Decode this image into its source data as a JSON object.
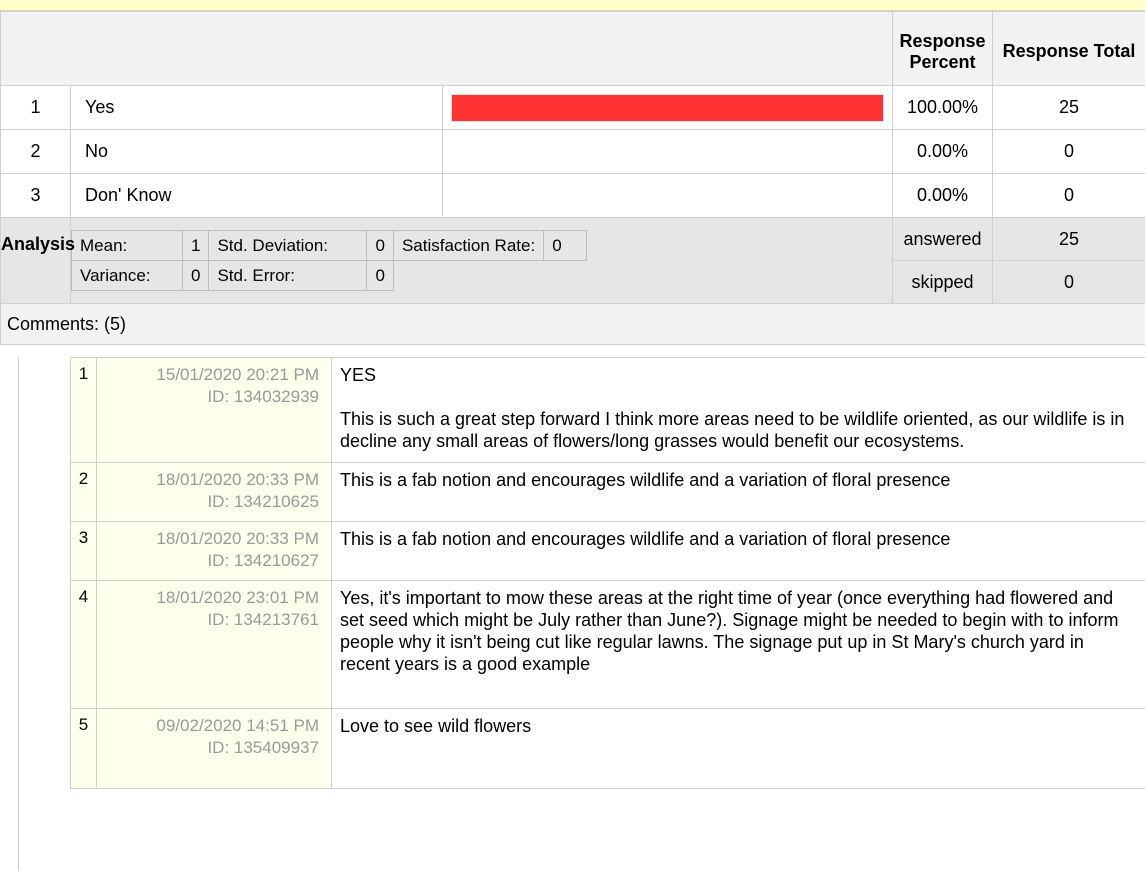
{
  "columns": {
    "response_percent": "Response Percent",
    "response_total": "Response Total"
  },
  "answers": [
    {
      "num": "1",
      "label": "Yes",
      "fraction": 1.0,
      "percent": "100.00%",
      "total": "25"
    },
    {
      "num": "2",
      "label": "No",
      "fraction": 0.0,
      "percent": "0.00%",
      "total": "0"
    },
    {
      "num": "3",
      "label": "Don' Know",
      "fraction": 0.0,
      "percent": "0.00%",
      "total": "0"
    }
  ],
  "analysis": {
    "label": "Analysis",
    "mean_label": "Mean:",
    "mean": "1",
    "std_dev_label": "Std. Deviation:",
    "std_dev": "0",
    "satisfaction_label": "Satisfaction Rate:",
    "satisfaction": "0",
    "variance_label": "Variance:",
    "variance": "0",
    "std_error_label": "Std. Error:",
    "std_error": "0"
  },
  "summary": {
    "answered_label": "answered",
    "answered": "25",
    "skipped_label": "skipped",
    "skipped": "0"
  },
  "comments_header": "Comments: (5)",
  "comments": [
    {
      "num": "1",
      "date": "15/01/2020 20:21 PM",
      "id": "ID: 134032939",
      "text": [
        "YES",
        "This is such a great step forward I think more areas need to be wildlife oriented, as our wildlife is in decline any small areas of flowers/long grasses would benefit our ecosystems."
      ]
    },
    {
      "num": "2",
      "date": "18/01/2020 20:33 PM",
      "id": "ID: 134210625",
      "text": [
        "This is a fab notion and encourages wildlife and a variation of floral presence"
      ]
    },
    {
      "num": "3",
      "date": "18/01/2020 20:33 PM",
      "id": "ID: 134210627",
      "text": [
        "This is a fab notion and encourages wildlife and a variation of floral presence"
      ]
    },
    {
      "num": "4",
      "date": "18/01/2020 23:01 PM",
      "id": "ID: 134213761",
      "text": [
        "Yes, it's important to mow these areas at the right time of year (once everything had flowered and set seed which might be July rather than June?). Signage might be needed to begin with to inform people why it isn't being cut like regular lawns. The signage put up in St Mary's church yard in recent years is a good example"
      ]
    },
    {
      "num": "5",
      "date": "09/02/2020 14:51 PM",
      "id": "ID: 135409937",
      "text": [
        "Love to see wild flowers"
      ]
    }
  ],
  "colors": {
    "bar": "#ff3333",
    "header_bg": "#f2f2f2",
    "analysis_bg": "#e6e6e6",
    "comment_meta_bg": "#ffffee",
    "top_band": "#ffffcc"
  }
}
